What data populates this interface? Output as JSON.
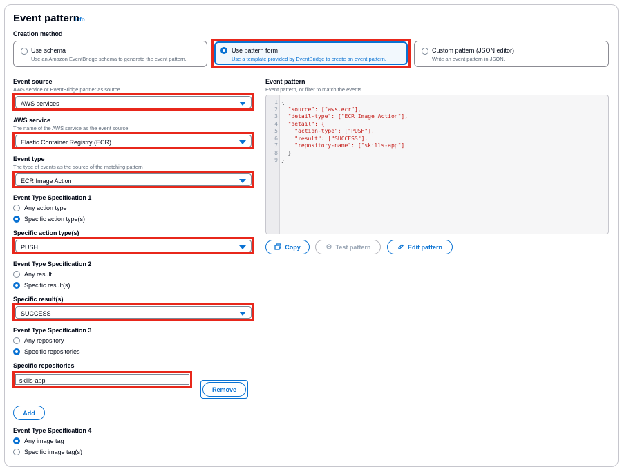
{
  "section": {
    "title": "Event pattern",
    "info": "Info"
  },
  "creation_method": {
    "label": "Creation method",
    "options": [
      {
        "name": "Use schema",
        "desc": "Use an Amazon EventBridge schema to generate the event pattern."
      },
      {
        "name": "Use pattern form",
        "desc": "Use a template provided by EventBridge to create an event pattern."
      },
      {
        "name": "Custom pattern (JSON editor)",
        "desc": "Write an event pattern in JSON."
      }
    ],
    "selected": "Use pattern form"
  },
  "event_source": {
    "label": "Event source",
    "desc": "AWS service or EventBridge partner as source",
    "value": "AWS services"
  },
  "aws_service": {
    "label": "AWS service",
    "desc": "The name of the AWS service as the event source",
    "value": "Elastic Container Registry (ECR)"
  },
  "event_type": {
    "label": "Event type",
    "desc": "The type of events as the source of the matching pattern",
    "value": "ECR Image Action"
  },
  "spec1": {
    "label": "Event Type Specification 1",
    "options": [
      "Any action type",
      "Specific action type(s)"
    ],
    "selected": "Specific action type(s)"
  },
  "action_types": {
    "label": "Specific action type(s)",
    "value": "PUSH"
  },
  "spec2": {
    "label": "Event Type Specification 2",
    "options": [
      "Any result",
      "Specific result(s)"
    ],
    "selected": "Specific result(s)"
  },
  "results": {
    "label": "Specific result(s)",
    "value": "SUCCESS"
  },
  "spec3": {
    "label": "Event Type Specification 3",
    "options": [
      "Any repository",
      "Specific repositories"
    ],
    "selected": "Specific repositories"
  },
  "repos": {
    "label": "Specific repositories",
    "value": "skills-app",
    "remove": "Remove",
    "add": "Add"
  },
  "spec4": {
    "label": "Event Type Specification 4",
    "options": [
      "Any image tag",
      "Specific image tag(s)"
    ],
    "selected": "Any image tag"
  },
  "pattern": {
    "label": "Event pattern",
    "desc": "Event pattern, or filter to match the events",
    "line_numbers": [
      "1",
      "2",
      "3",
      "4",
      "5",
      "6",
      "7",
      "8",
      "9"
    ],
    "code_lines": [
      "{",
      "  \"source\": [\"aws.ecr\"],",
      "  \"detail-type\": [\"ECR Image Action\"],",
      "  \"detail\": {",
      "    \"action-type\": [\"PUSH\"],",
      "    \"result\": [\"SUCCESS\"],",
      "    \"repository-name\": [\"skills-app\"]",
      "  }",
      "}"
    ],
    "buttons": {
      "copy": "Copy",
      "test": "Test pattern",
      "edit": "Edit pattern"
    }
  },
  "colors": {
    "accent": "#0972d3",
    "highlight": "#e8271b"
  }
}
